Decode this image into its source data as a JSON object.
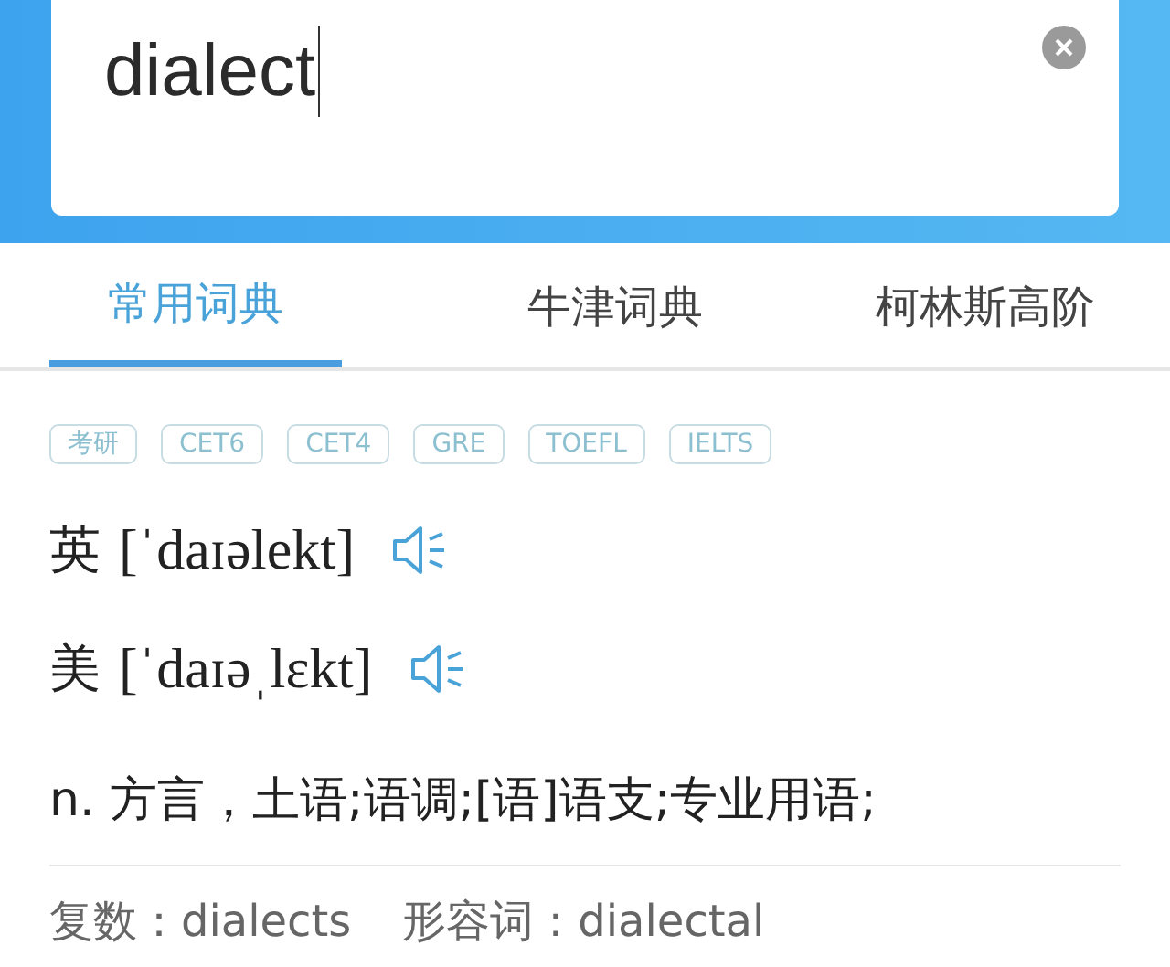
{
  "search": {
    "value": "dialect"
  },
  "tabs": [
    {
      "label": "常用词典",
      "selected": true
    },
    {
      "label": "牛津词典",
      "selected": false
    },
    {
      "label": "柯林斯高阶",
      "selected": false
    }
  ],
  "tags": [
    "考研",
    "CET6",
    "CET4",
    "GRE",
    "TOEFL",
    "IELTS"
  ],
  "pronunciations": [
    {
      "region": "英",
      "phonetic": "[ˈdaɪəlekt]"
    },
    {
      "region": "美",
      "phonetic": "[ˈdaɪəˌlɛkt]"
    }
  ],
  "definition": "n. 方言，土语;语调;[语]语支;专业用语;",
  "inflections": [
    {
      "text": "复数：dialects"
    },
    {
      "text": "形容词：dialectal"
    }
  ]
}
